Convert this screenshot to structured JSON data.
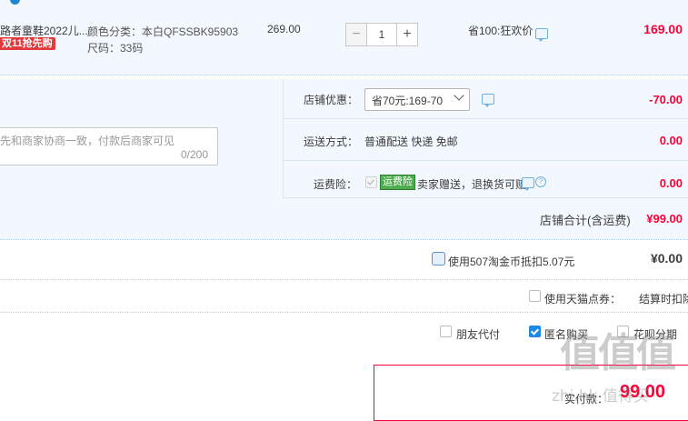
{
  "item": {
    "title": "路者童鞋2022儿...",
    "promo_badge": "双11抢先购",
    "sku_color": "颜色分类：本白QFSSBK95903",
    "sku_size": "尺码：33码",
    "price": "269.00",
    "quantity": "1",
    "saving": "省100:狂欢价",
    "total": "169.00"
  },
  "store": {
    "discount_label": "店铺优惠：",
    "discount_selected": "省70元:169-70",
    "discount_amount": "-70.00",
    "message_placeholder": "先和商家协商一致，付款后商家可见",
    "message_count": "0/200",
    "shipping_label": "运送方式：",
    "shipping_value": "普通配送 快递 免邮",
    "shipping_amount": "0.00",
    "insurance_label": "运费险：",
    "insurance_badge": "运费险",
    "insurance_text": "卖家赠送，退换货可赔",
    "insurance_amount": "0.00",
    "total_label": "店铺合计(含运费)",
    "total_amount": "¥99.00"
  },
  "checkout": {
    "coin_label": "使用507淘金币抵扣5.07元",
    "coin_amount": "¥0.00",
    "points_label": "使用天猫点券：",
    "points_note": "结算时扣除",
    "friend_pay": "朋友代付",
    "anonymous": "匿名购买",
    "huabei": "花呗分期",
    "pay_label": "实付款：",
    "pay_amount": "99.00"
  },
  "watermark": {
    "logo": "值值值",
    "site": "zhi.hk 值得买"
  },
  "colors": {
    "accent_red": "#ff0036",
    "panel_blue": "#f2f8fd",
    "badge_red": "#e4393c",
    "badge_green": "#4cae4c"
  }
}
